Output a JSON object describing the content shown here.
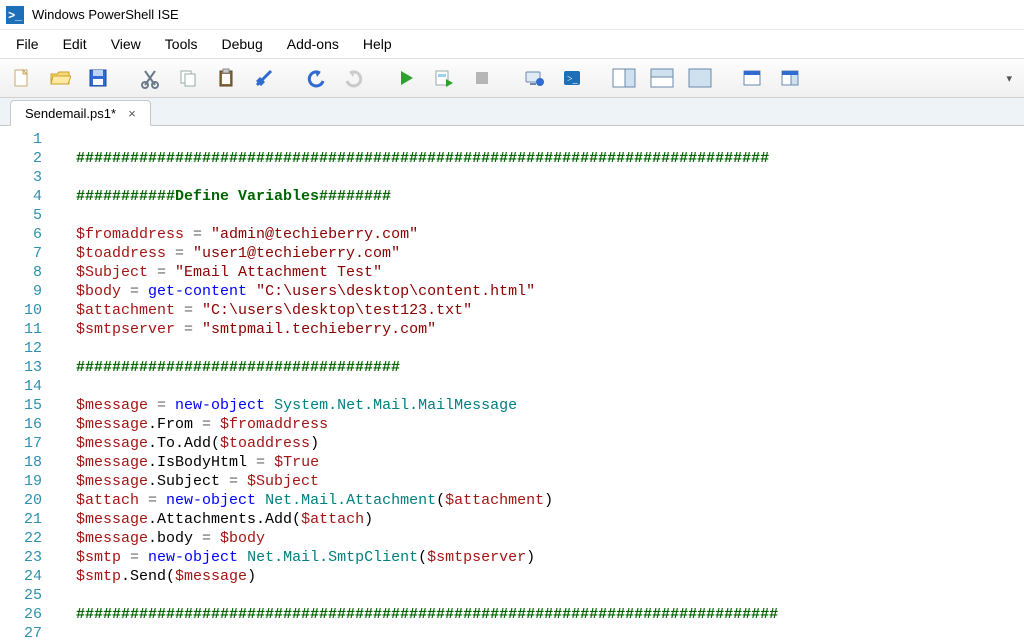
{
  "window": {
    "title": "Windows PowerShell ISE"
  },
  "menu": {
    "file": "File",
    "edit": "Edit",
    "view": "View",
    "tools": "Tools",
    "debug": "Debug",
    "addons": "Add-ons",
    "help": "Help"
  },
  "toolbar": {
    "new": "New",
    "open": "Open",
    "save": "Save",
    "cut": "Cut",
    "copy": "Copy",
    "paste": "Paste",
    "clear": "Clear",
    "undo": "Undo",
    "redo": "Redo",
    "run": "Run Script",
    "run_selection": "Run Selection",
    "stop": "Stop",
    "remote": "New Remote PowerShell Tab",
    "start_ps": "Start PowerShell.exe",
    "pane_side": "Show Script Pane Right",
    "pane_top": "Show Script Pane Top",
    "pane_max": "Show Script Pane Maximized",
    "show_cmd": "Show Command Window",
    "show_cmd_addon": "Show Command Add-on"
  },
  "tab": {
    "label": "Sendemail.ps1*",
    "close": "×"
  },
  "code": {
    "lines": 27,
    "l1": "#############################################################################",
    "l3": "###########Define Variables########",
    "l5v": "$fromaddress",
    "l5s": "\"admin@techieberry.com\"",
    "l6v": "$toaddress",
    "l6s": "\"user1@techieberry.com\"",
    "l7v": "$Subject",
    "l7s": "\"Email Attachment Test\"",
    "l8v": "$body",
    "l8c": "get-content",
    "l8s": "\"C:\\users\\desktop\\content.html\"",
    "l9v": "$attachment",
    "l9s": "\"C:\\users\\desktop\\test123.txt\"",
    "l10v": "$smtpserver",
    "l10s": "\"smtpmail.techieberry.com\"",
    "l12": "####################################",
    "l14v": "$message",
    "l14c": "new-object",
    "l14t": "System.Net.Mail.MailMessage",
    "l15a": "$message",
    "l15m": ".From",
    "l15b": "$fromaddress",
    "l16a": "$message",
    "l16m": ".To.Add",
    "l16b": "$toaddress",
    "l17a": "$message",
    "l17m": ".IsBodyHtml",
    "l17b": "$True",
    "l18a": "$message",
    "l18m": ".Subject",
    "l18b": "$Subject",
    "l19v": "$attach",
    "l19c": "new-object",
    "l19t": "Net.Mail.Attachment",
    "l19b": "$attachment",
    "l20a": "$message",
    "l20m": ".Attachments.Add",
    "l20b": "$attach",
    "l21a": "$message",
    "l21m": ".body",
    "l21b": "$body",
    "l22v": "$smtp",
    "l22c": "new-object",
    "l22t": "Net.Mail.SmtpClient",
    "l22b": "$smtpserver",
    "l23a": "$smtp",
    "l23m": ".Send",
    "l23b": "$message",
    "l25": "##############################################################################",
    "eq": " = ",
    "sp": " ",
    "lp": "(",
    "rp": ")"
  }
}
